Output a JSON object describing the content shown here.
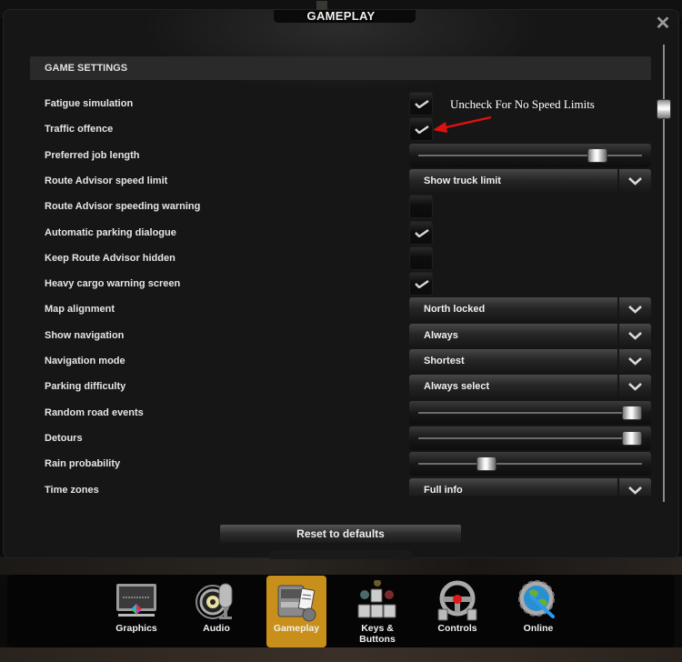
{
  "window": {
    "title": "GAMEPLAY",
    "close_label": "✕"
  },
  "section": {
    "title": "GAME SETTINGS"
  },
  "annotation": {
    "text": "Uncheck For No Speed Limits",
    "arrow_color": "#e01010"
  },
  "settings": [
    {
      "label": "Fatigue simulation",
      "type": "checkbox",
      "checked": true
    },
    {
      "label": "Traffic offence",
      "type": "checkbox",
      "checked": true
    },
    {
      "label": "Preferred job length",
      "type": "slider",
      "value": 0.83
    },
    {
      "label": "Route Advisor speed limit",
      "type": "dropdown",
      "value": "Show truck limit"
    },
    {
      "label": "Route Advisor speeding warning",
      "type": "checkbox",
      "checked": false
    },
    {
      "label": "Automatic parking dialogue",
      "type": "checkbox",
      "checked": true
    },
    {
      "label": "Keep Route Advisor hidden",
      "type": "checkbox",
      "checked": false
    },
    {
      "label": "Heavy cargo warning screen",
      "type": "checkbox",
      "checked": true
    },
    {
      "label": "Map alignment",
      "type": "dropdown",
      "value": "North locked"
    },
    {
      "label": "Show navigation",
      "type": "dropdown",
      "value": "Always"
    },
    {
      "label": "Navigation mode",
      "type": "dropdown",
      "value": "Shortest"
    },
    {
      "label": "Parking difficulty",
      "type": "dropdown",
      "value": "Always select"
    },
    {
      "label": "Random road events",
      "type": "slider",
      "value": 1.0
    },
    {
      "label": "Detours",
      "type": "slider",
      "value": 1.0
    },
    {
      "label": "Rain probability",
      "type": "slider",
      "value": 0.29
    },
    {
      "label": "Time zones",
      "type": "dropdown",
      "value": "Full info"
    }
  ],
  "scrollbar": {
    "position": 0.12
  },
  "reset_label": "Reset to defaults",
  "dock": {
    "active_color": "#c8901a",
    "items": [
      {
        "label": "Graphics",
        "icon": "monitor-icon",
        "active": false
      },
      {
        "label": "Audio",
        "icon": "microphone-icon",
        "active": false
      },
      {
        "label": "Gameplay",
        "icon": "truck-icon",
        "active": true
      },
      {
        "label": "Keys & Buttons",
        "icon": "keyboard-icon",
        "active": false
      },
      {
        "label": "Controls",
        "icon": "steering-wheel-icon",
        "active": false
      },
      {
        "label": "Online",
        "icon": "globe-gear-icon",
        "active": false
      }
    ]
  }
}
